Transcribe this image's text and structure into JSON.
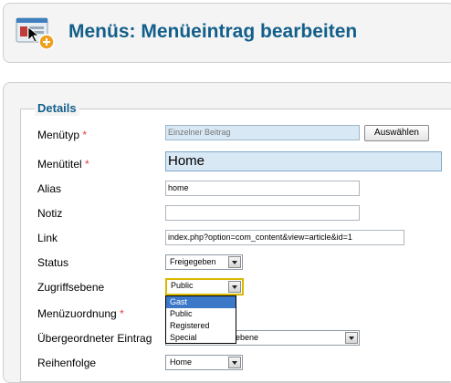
{
  "header": {
    "title": "Menüs: Menüeintrag bearbeiten"
  },
  "details": {
    "legend": "Details",
    "fields": {
      "menutype": {
        "label": "Menütyp",
        "value": "Einzelner Beitrag",
        "button": "Auswählen"
      },
      "menutitle": {
        "label": "Menütitel",
        "value": "Home"
      },
      "alias": {
        "label": "Alias",
        "value": "home"
      },
      "notiz": {
        "label": "Notiz",
        "value": ""
      },
      "link": {
        "label": "Link",
        "value": "index.php?option=com_content&view=article&id=1"
      },
      "status": {
        "label": "Status",
        "value": "Freigegeben"
      },
      "access": {
        "label": "Zugriffsebene",
        "value": "Public",
        "options": [
          "Gast",
          "Public",
          "Registered",
          "Special"
        ]
      },
      "menuassign": {
        "label": "Menüzuordnung"
      },
      "parent": {
        "label": "Übergeordneter Eintrag",
        "value": "ebene"
      },
      "order": {
        "label": "Reihenfolge",
        "value": "Home"
      }
    },
    "required_marker": "*"
  },
  "colors": {
    "accent": "#135f8a",
    "required": "#e23d3d",
    "highlight": "#3c78c8",
    "focus": "#dab700"
  }
}
